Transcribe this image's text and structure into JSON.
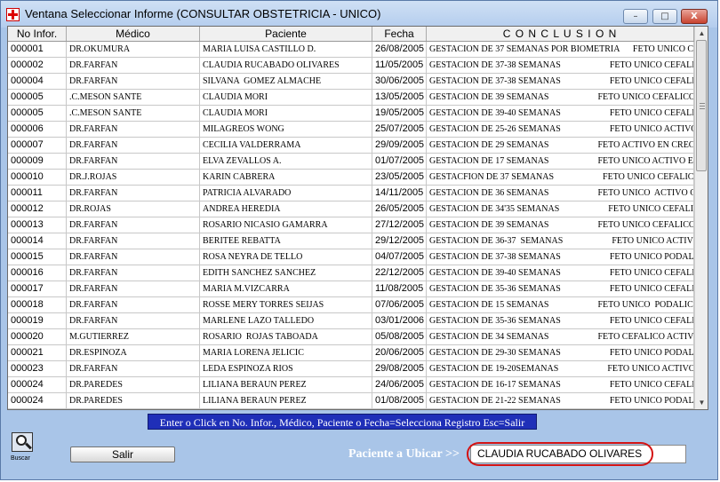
{
  "window": {
    "title": "Ventana Seleccionar Informe (CONSULTAR OBSTETRICIA - UNICO)",
    "minimize_label": "–",
    "maximize_label": "□",
    "close_label": "X"
  },
  "grid": {
    "columns": [
      "No Infor.",
      "Médico",
      "Paciente",
      "Fecha",
      "C O N C L U S I O N"
    ],
    "rows": [
      [
        "000001",
        "DR.OKUMURA",
        "MARIA LUISA CASTILLO D.",
        "26/08/2005",
        "GESTACION DE 37 SEMANAS POR BIOMETRIA      FETO UNICO CEF."
      ],
      [
        "000002",
        "DR.FARFAN",
        "CLAUDIA RUCABADO OLIVARES",
        "11/05/2005",
        "GESTACION DE 37-38 SEMANAS                      FETO UNICO CEFALICO AC"
      ],
      [
        "000004",
        "DR.FARFAN",
        "SILVANA  GOMEZ ALMACHE",
        "30/06/2005",
        "GESTACION DE 37-38 SEMANAS                      FETO UNICO CEFALICO AC"
      ],
      [
        "000005",
        ".C.MESON SANTE",
        "CLAUDIA MORI",
        "13/05/2005",
        "GESTACION DE 39 SEMANAS                      FETO UNICO CEFALICO ACT"
      ],
      [
        "000005",
        ".C.MESON SANTE",
        "CLAUDIA MORI",
        "19/05/2005",
        "GESTACION DE 39-40 SEMANAS                      FETO UNICO CEFALICO AC"
      ],
      [
        "000006",
        "DR.FARFAN",
        "MILAGREOS WONG",
        "25/07/2005",
        "GESTACION DE 25-26 SEMANAS                      FETO UNICO ACTIVO EN C"
      ],
      [
        "000007",
        "DR.FARFAN",
        "CECILIA VALDERRAMA",
        "29/09/2005",
        "GESTACION DE 29 SEMANAS                      FETO ACTIVO EN CRECIMIEI"
      ],
      [
        "000009",
        "DR.FARFAN",
        "ELVA ZEVALLOS A.",
        "01/07/2005",
        "GESTACION DE 17 SEMANAS                      FETO UNICO ACTIVO EN CRI"
      ],
      [
        "000010",
        "DR.J.ROJAS",
        "KARIN CABRERA",
        "23/05/2005",
        "GESTACFION DE 37 SEMANAS                      FETO UNICO CEFALICO ACT"
      ],
      [
        "000011",
        "DR.FARFAN",
        "PATRICIA ALVARADO",
        "14/11/2005",
        "GESTACION DE 36 SEMANAS                      FETO UNICO  ACTIVO CON R"
      ],
      [
        "000012",
        "DR.ROJAS",
        "ANDREA HEREDIA",
        "26/05/2005",
        "GESTACION DE 34'35 SEMANAS                      FETO UNICO CEFALICO AC"
      ],
      [
        "000013",
        "DR.FARFAN",
        "ROSARIO NICASIO GAMARRA",
        "27/12/2005",
        "GESTACION DE 39 SEMANAS                      FETO UNICO CEFALICO ACT"
      ],
      [
        "000014",
        "DR.FARFAN",
        "BERITEE REBATTA",
        "29/12/2005",
        "GESTACION DE 36-37  SEMANAS                      FETO UNICO ACTIVO EN C"
      ],
      [
        "000015",
        "DR.FARFAN",
        "ROSA NEYRA DE TELLO",
        "04/07/2005",
        "GESTACION DE 37-38 SEMANAS                      FETO UNICO PODALICO A"
      ],
      [
        "000016",
        "DR.FARFAN",
        "EDITH SANCHEZ SANCHEZ",
        "22/12/2005",
        "GESTACION DE 39-40 SEMANAS                      FETO UNICO CEFALICO AC"
      ],
      [
        "000017",
        "DR.FARFAN",
        "MARIA M.VIZCARRA",
        "11/08/2005",
        "GESTACION DE 35-36 SEMANAS                      FETO UNICO CEFALICO AC"
      ],
      [
        "000018",
        "DR.FARFAN",
        "ROSSE MERY TORRES SEIJAS",
        "07/06/2005",
        "GESTACION DE 15 SEMANAS                      FETO UNICO  PODALICO AC"
      ],
      [
        "000019",
        "DR.FARFAN",
        "MARLENE LAZO TALLEDO",
        "03/01/2006",
        "GESTACION DE 35-36 SEMANAS                      FETO UNICO CEFALICO AC"
      ],
      [
        "000020",
        "M.GUTIERREZ",
        "ROSARIO  ROJAS TABOADA",
        "05/08/2005",
        "GESTACION DE 34 SEMANAS                      FETO CEFALICO ACTIVO CR"
      ],
      [
        "000021",
        "DR.ESPINOZA",
        "MARIA LORENA JELICIC",
        "20/06/2005",
        "GESTACION DE 29-30 SEMANAS                      FETO UNICO PODALICO A"
      ],
      [
        "000023",
        "DR.FARFAN",
        "LEDA ESPINOZA RIOS",
        "29/08/2005",
        "GESTACION DE 19-20SEMANAS                      FETO UNICO ACTIVO EN C"
      ],
      [
        "000024",
        "DR.PAREDES",
        "LILIANA BERAUN PEREZ",
        "24/06/2005",
        "GESTACION DE 16-17 SEMANAS                      FETO UNICO CEFALICO EN"
      ],
      [
        "000024",
        "DR.PAREDES",
        "LILIANA BERAUN PEREZ",
        "01/08/2005",
        "GESTACION DE 21-22 SEMANAS                      FETO UNICO PODALICO E"
      ]
    ]
  },
  "help_text": "Enter o Click en No. Infor., Médico, Paciente o Fecha=Selecciona Registro     Esc=Salir",
  "footer": {
    "buscar_label": "Buscar",
    "buscar_icon": "magnifier-icon",
    "salir_label": "Salir",
    "ubicar_label": "Paciente a Ubicar >>",
    "ubicar_value": "CLAUDIA RUCABADO OLIVARES"
  },
  "colors": {
    "window_bg": "#a9c5e8",
    "help_bar_bg": "#1f2fb8",
    "highlight_ring": "#d41414",
    "close_button": "#c8422f"
  }
}
